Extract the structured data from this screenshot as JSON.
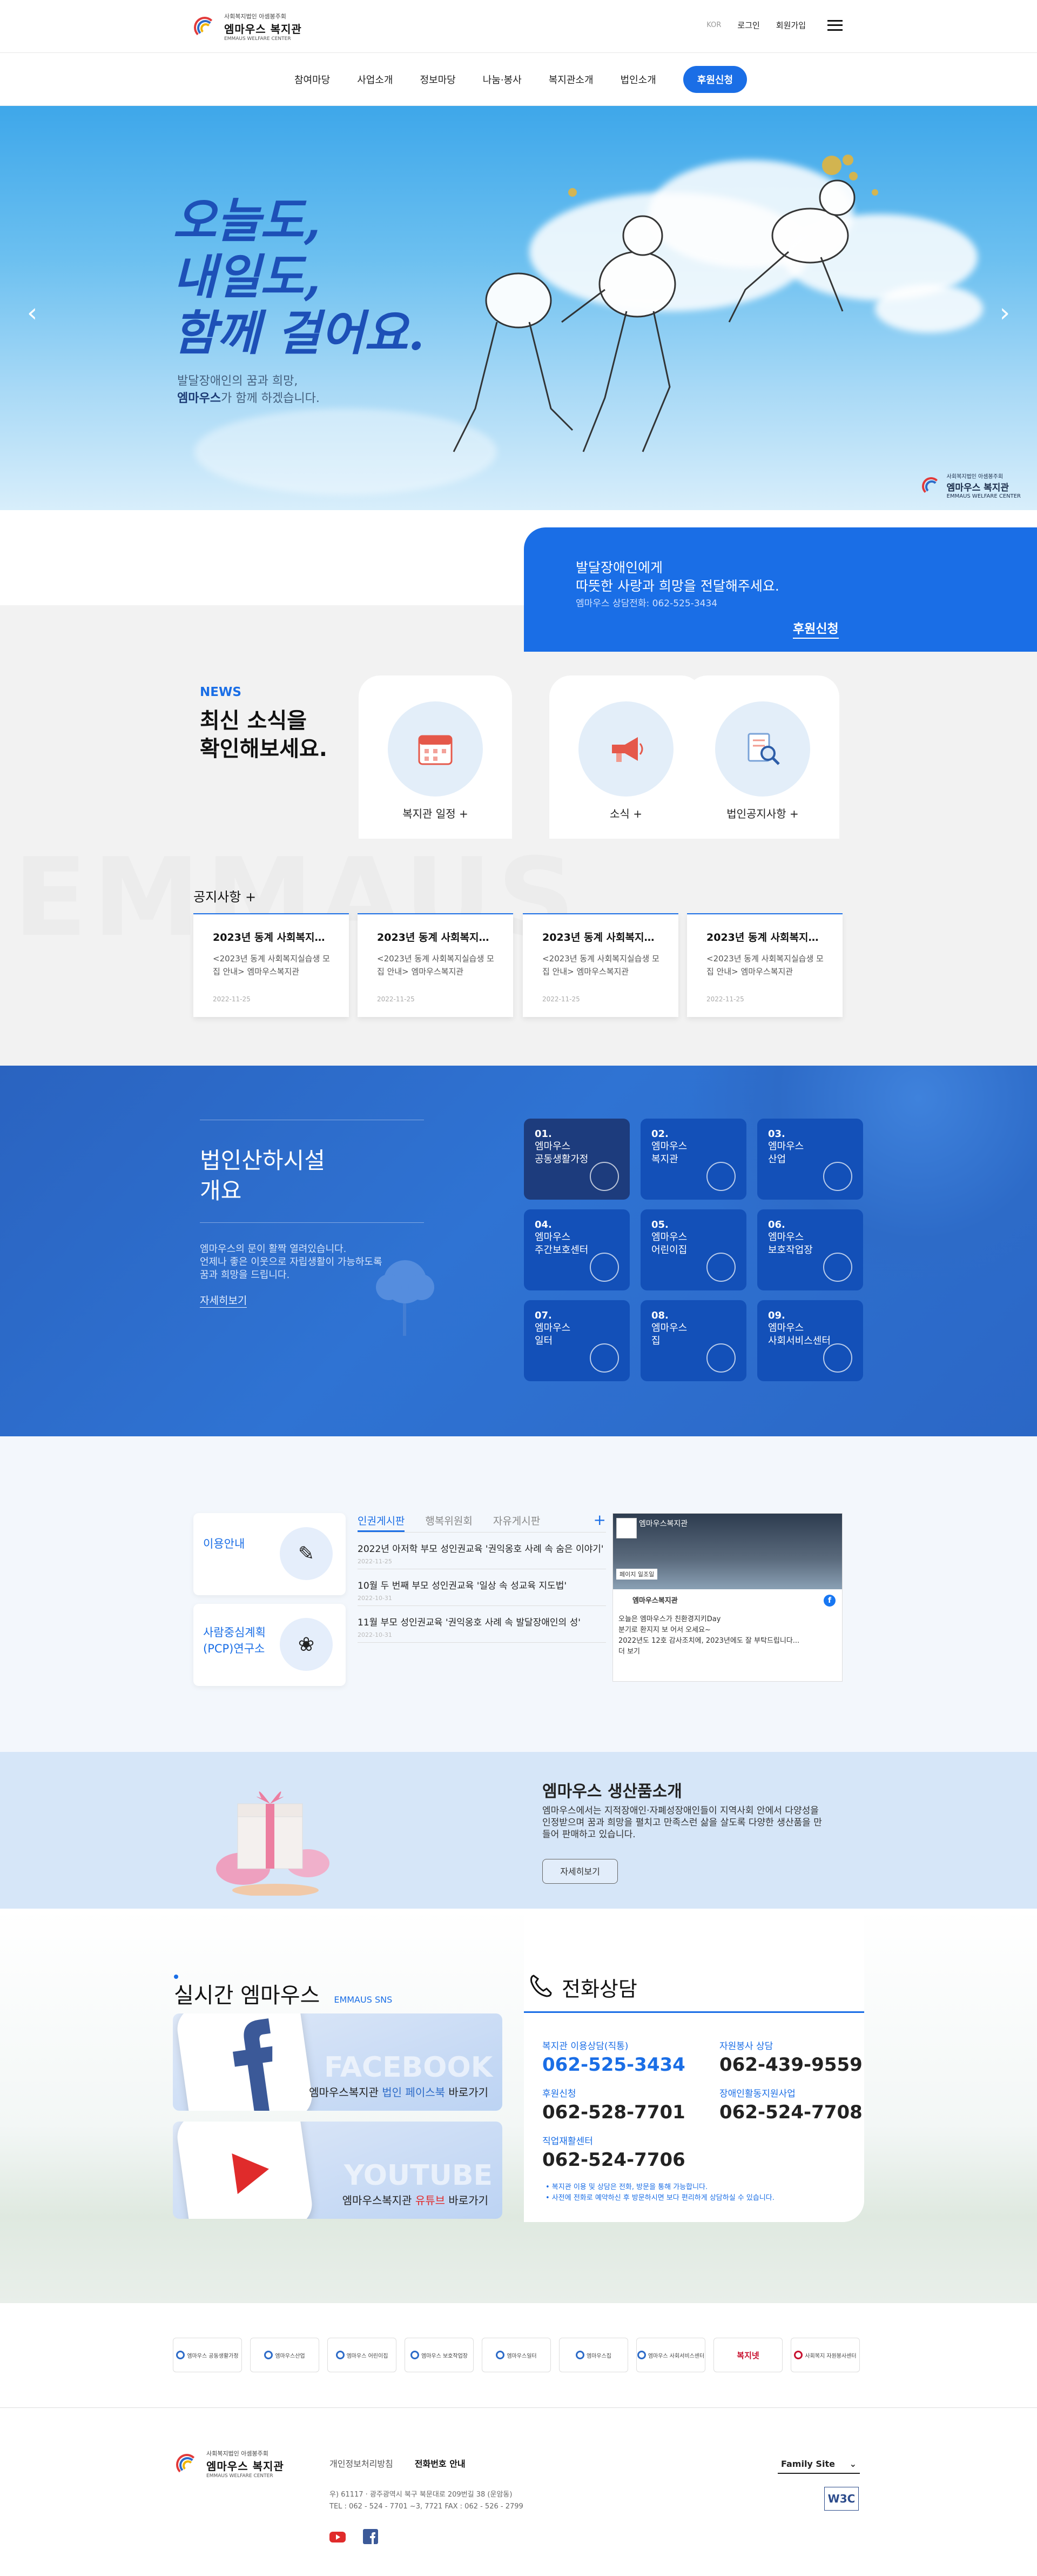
{
  "header": {
    "logo_small": "사회복지법인 아셈봉주회",
    "logo_name": "엠마우스 복지관",
    "logo_en": "EMMAUS WELFARE CENTER",
    "util": {
      "lang": "KOR",
      "login": "로그인",
      "join": "회원가입"
    }
  },
  "gnb": [
    "참여마당",
    "사업소개",
    "정보마당",
    "나눔·봉사",
    "복지관소개",
    "법인소개"
  ],
  "gnb_join": "후원신청",
  "hero": {
    "headline": [
      "오늘도,",
      "내일도,",
      "함께 걸어요."
    ],
    "sub_line1": "발달장애인의 꿈과 희망,",
    "sub_brand": "엠마우스",
    "sub_line2": "가 함께 하겠습니다.",
    "badge_small": "사회복지법인 아셈봉주회",
    "badge_name": "엠마우스 복지관",
    "badge_en": "EMMAUS WELFARE CENTER"
  },
  "donate": {
    "line1": "발달장애인에게",
    "line2": "따뜻한 사랑과 희망을 전달해주세요.",
    "tel": "엠마우스 상담전화: 062-525-3434",
    "button": "후원신청"
  },
  "news": {
    "en": "NEWS",
    "title1": "최신 소식을",
    "title2": "확인해보세요.",
    "bg_text": "EMMAUS",
    "cards": [
      {
        "label": "복지관 일정",
        "icon": "calendar-icon"
      },
      {
        "label": "소식",
        "icon": "megaphone-icon"
      },
      {
        "label": "법인공지사항",
        "icon": "document-search-icon"
      }
    ],
    "plus": "+"
  },
  "notices": {
    "title": "공지사항 +",
    "items": [
      {
        "title": "2023년 동계 사회복지실습생 모집",
        "body": "<2023년 동계 사회복지실습생 모집 안내> 엠마우스복지관",
        "date": "2022-11-25"
      },
      {
        "title": "2023년 동계 사회복지실습생 모집",
        "body": "<2023년 동계 사회복지실습생 모집 안내> 엠마우스복지관",
        "date": "2022-11-25"
      },
      {
        "title": "2023년 동계 사회복지실습생 모집",
        "body": "<2023년 동계 사회복지실습생 모집 안내> 엠마우스복지관",
        "date": "2022-11-25"
      },
      {
        "title": "2023년 동계 사회복지실습생 모집",
        "body": "<2023년 동계 사회복지실습생 모집 안내> 엠마우스복지관",
        "date": "2022-11-25"
      }
    ]
  },
  "facilities": {
    "title1": "법인산하시설",
    "title2": "개요",
    "desc1": "엠마우스의 문이 활짝 열려있습니다.",
    "desc2": "언제나 좋은 이웃으로 자립생활이 가능하도록",
    "desc3": "꿈과 희망을 드립니다.",
    "more": "자세히보기",
    "items": [
      {
        "num": "01.",
        "name1": "엠마우스",
        "name2": "공동생활가정"
      },
      {
        "num": "02.",
        "name1": "엠마우스",
        "name2": "복지관"
      },
      {
        "num": "03.",
        "name1": "엠마우스",
        "name2": "산업"
      },
      {
        "num": "04.",
        "name1": "엠마우스",
        "name2": "주간보호센터"
      },
      {
        "num": "05.",
        "name1": "엠마우스",
        "name2": "어린이집"
      },
      {
        "num": "06.",
        "name1": "엠마우스",
        "name2": "보호작업장"
      },
      {
        "num": "07.",
        "name1": "엠마우스",
        "name2": "일터"
      },
      {
        "num": "08.",
        "name1": "엠마우스",
        "name2": "집"
      },
      {
        "num": "09.",
        "name1": "엠마우스",
        "name2": "사회서비스센터"
      }
    ]
  },
  "guide": {
    "box1": "이용안내",
    "box2_1": "사람중심계획",
    "box2_2": "(PCP)연구소"
  },
  "board": {
    "tabs": [
      "인권게시판",
      "행복위원회",
      "자유게시판"
    ],
    "plus": "+",
    "items": [
      {
        "title": "2022년 아저학 부모 성인권교육 '권익옹호 사례 속 숨은 이야기'",
        "date": "2022-11-25"
      },
      {
        "title": "10월 두 번째 부모 성인권교육 '일상 속 성교육 지도법'",
        "date": "2022-10-31"
      },
      {
        "title": "11월 부모 성인권교육 '권익옹호 사례 속 발달장애인의 성'",
        "date": "2022-10-31"
      }
    ]
  },
  "facebook": {
    "page": "엠마우스복지관",
    "button": "페이지 일조일",
    "name": "엠마우스복지관",
    "line1": "오늘은 엠마우스가 친환경지키Day",
    "line2": "분기로 환지지 보 어서 오세요~",
    "line3": "2022년도 12호 감사조치에, 2023년에도 잘 부탁드립니다...",
    "more": "더 보기"
  },
  "products": {
    "title": "엠마우스 생산품소개",
    "desc": "엠마우스에서는 지적장애인·자폐성장애인들이 지역사회 안에서 다양성을 인정받으며 꿈과 희망을 펼치고 만족스런 삶을 살도록 다양한 생산품을 만들어 판매하고 있습니다.",
    "button": "자세히보기"
  },
  "realtime": {
    "title": "실시간 엠마우스",
    "sub": "EMMAUS SNS",
    "fb_big": "FACEBOOK",
    "fb_pre": "엠마우스복지관 ",
    "fb_em": "법인 페이스북",
    "fb_post": " 바로가기",
    "yt_big": "YOUTUBE",
    "yt_pre": "엠마우스복지관 ",
    "yt_em": "유튜브",
    "yt_post": " 바로가기",
    "colors": {
      "facebook": "#3b5998",
      "youtube": "#e02b2b"
    }
  },
  "call": {
    "title": "전화상담",
    "nums": [
      {
        "label": "복지관 이용상담(직통)",
        "value": "062-525-3434"
      },
      {
        "label": "자원봉사 상담",
        "value": "062-439-9559"
      },
      {
        "label": "후원신청",
        "value": "062-528-7701"
      },
      {
        "label": "장애인활동지원사업",
        "value": "062-524-7708"
      },
      {
        "label": "직업재활센터",
        "value": "062-524-7706"
      }
    ],
    "note1": "• 복지관 이용 및 상담은 전화, 방문을 통해 가능합니다.",
    "note2": "• 사전에 전화로 예약하신 후 방문하시면 보다 편리하게 상담하실 수 있습니다."
  },
  "banners": [
    "엠마우스 공동생활가정",
    "엠마우스산업",
    "엠마우스 어린이집",
    "엠마우스 보호작업장",
    "엠마우스일터",
    "엠마우스집",
    "엠마우스 사회서비스센터",
    "복지넷",
    "사회복지 자원봉사센터"
  ],
  "footer": {
    "link1": "개인정보처리방침",
    "link2": "전화번호 안내",
    "addr": "우) 61117 · 광주광역시 북구 북문대로 209번길 38 (운암동)",
    "tel": "TEL : 062 - 524 - 7701 ~3, 7721 FAX : 062 - 526 - 2799",
    "family": "Family Site",
    "w3c": "W3C"
  },
  "accent": "#1a6ee6"
}
